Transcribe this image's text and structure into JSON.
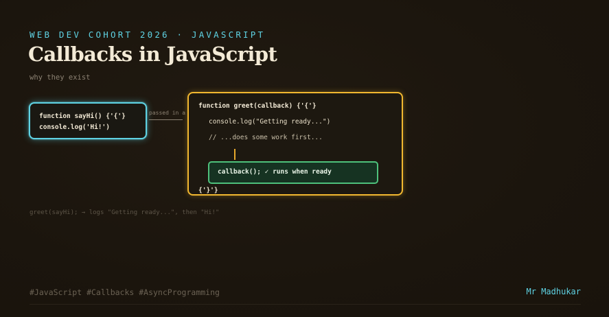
{
  "header": {
    "eyebrow": "WEB DEV COHORT 2026 · JAVASCRIPT",
    "title": "Callbacks in JavaScript",
    "subtitle": "why they exist"
  },
  "diagram": {
    "sayhi_card": {
      "line1": "function sayHi() {'{'}",
      "line2": "console.log('Hi!')"
    },
    "connector_label": "passed in as",
    "greet_card": {
      "signature": "function greet(callback) {'{'}",
      "log_line": "console.log(\"Getting ready...\")",
      "comment_line": "// ...does some work first...",
      "callback_line": "callback(); ✓ runs when ready",
      "closing": "{'}'}"
    },
    "result_note": "greet(sayHi); → logs \"Getting ready...\", then \"Hi!\""
  },
  "footer": {
    "tags": "#JavaScript #Callbacks #AsyncProgramming",
    "author": "Mr Madhukar"
  },
  "colors": {
    "background": "#1c160e",
    "accent_cyan": "#5fd3e4",
    "accent_amber": "#f2b830",
    "accent_green": "#4ec27c"
  }
}
